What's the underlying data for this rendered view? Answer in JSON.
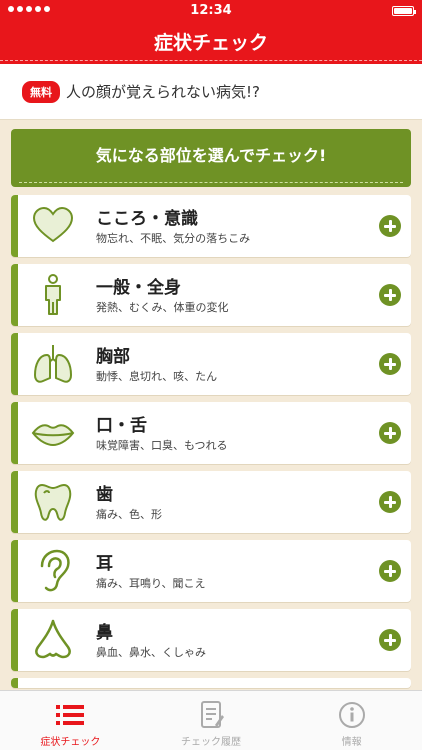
{
  "status_bar": {
    "time": "12:34"
  },
  "nav": {
    "title": "症状チェック"
  },
  "banner": {
    "badge": "無料",
    "text": "人の顔が覚えられない病気!?"
  },
  "section": {
    "title": "気になる部位を選んでチェック!"
  },
  "items": [
    {
      "title": "こころ・意識",
      "subtitle": "物忘れ、不眠、気分の落ちこみ",
      "icon": "heart-icon"
    },
    {
      "title": "一般・全身",
      "subtitle": "発熱、むくみ、体重の変化",
      "icon": "body-icon"
    },
    {
      "title": "胸部",
      "subtitle": "動悸、息切れ、咳、たん",
      "icon": "lungs-icon"
    },
    {
      "title": "口・舌",
      "subtitle": "味覚障害、口臭、もつれる",
      "icon": "lips-icon"
    },
    {
      "title": "歯",
      "subtitle": "痛み、色、形",
      "icon": "tooth-icon"
    },
    {
      "title": "耳",
      "subtitle": "痛み、耳鳴り、聞こえ",
      "icon": "ear-icon"
    },
    {
      "title": "鼻",
      "subtitle": "鼻血、鼻水、くしゃみ",
      "icon": "nose-icon"
    }
  ],
  "tabs": [
    {
      "label": "症状チェック",
      "icon": "list-icon",
      "active": true
    },
    {
      "label": "チェック履歴",
      "icon": "history-icon",
      "active": false
    },
    {
      "label": "情報",
      "icon": "info-icon",
      "active": false
    }
  ],
  "colors": {
    "brand_red": "#e8161b",
    "accent_green": "#6f9225",
    "background": "#f4ead8"
  }
}
